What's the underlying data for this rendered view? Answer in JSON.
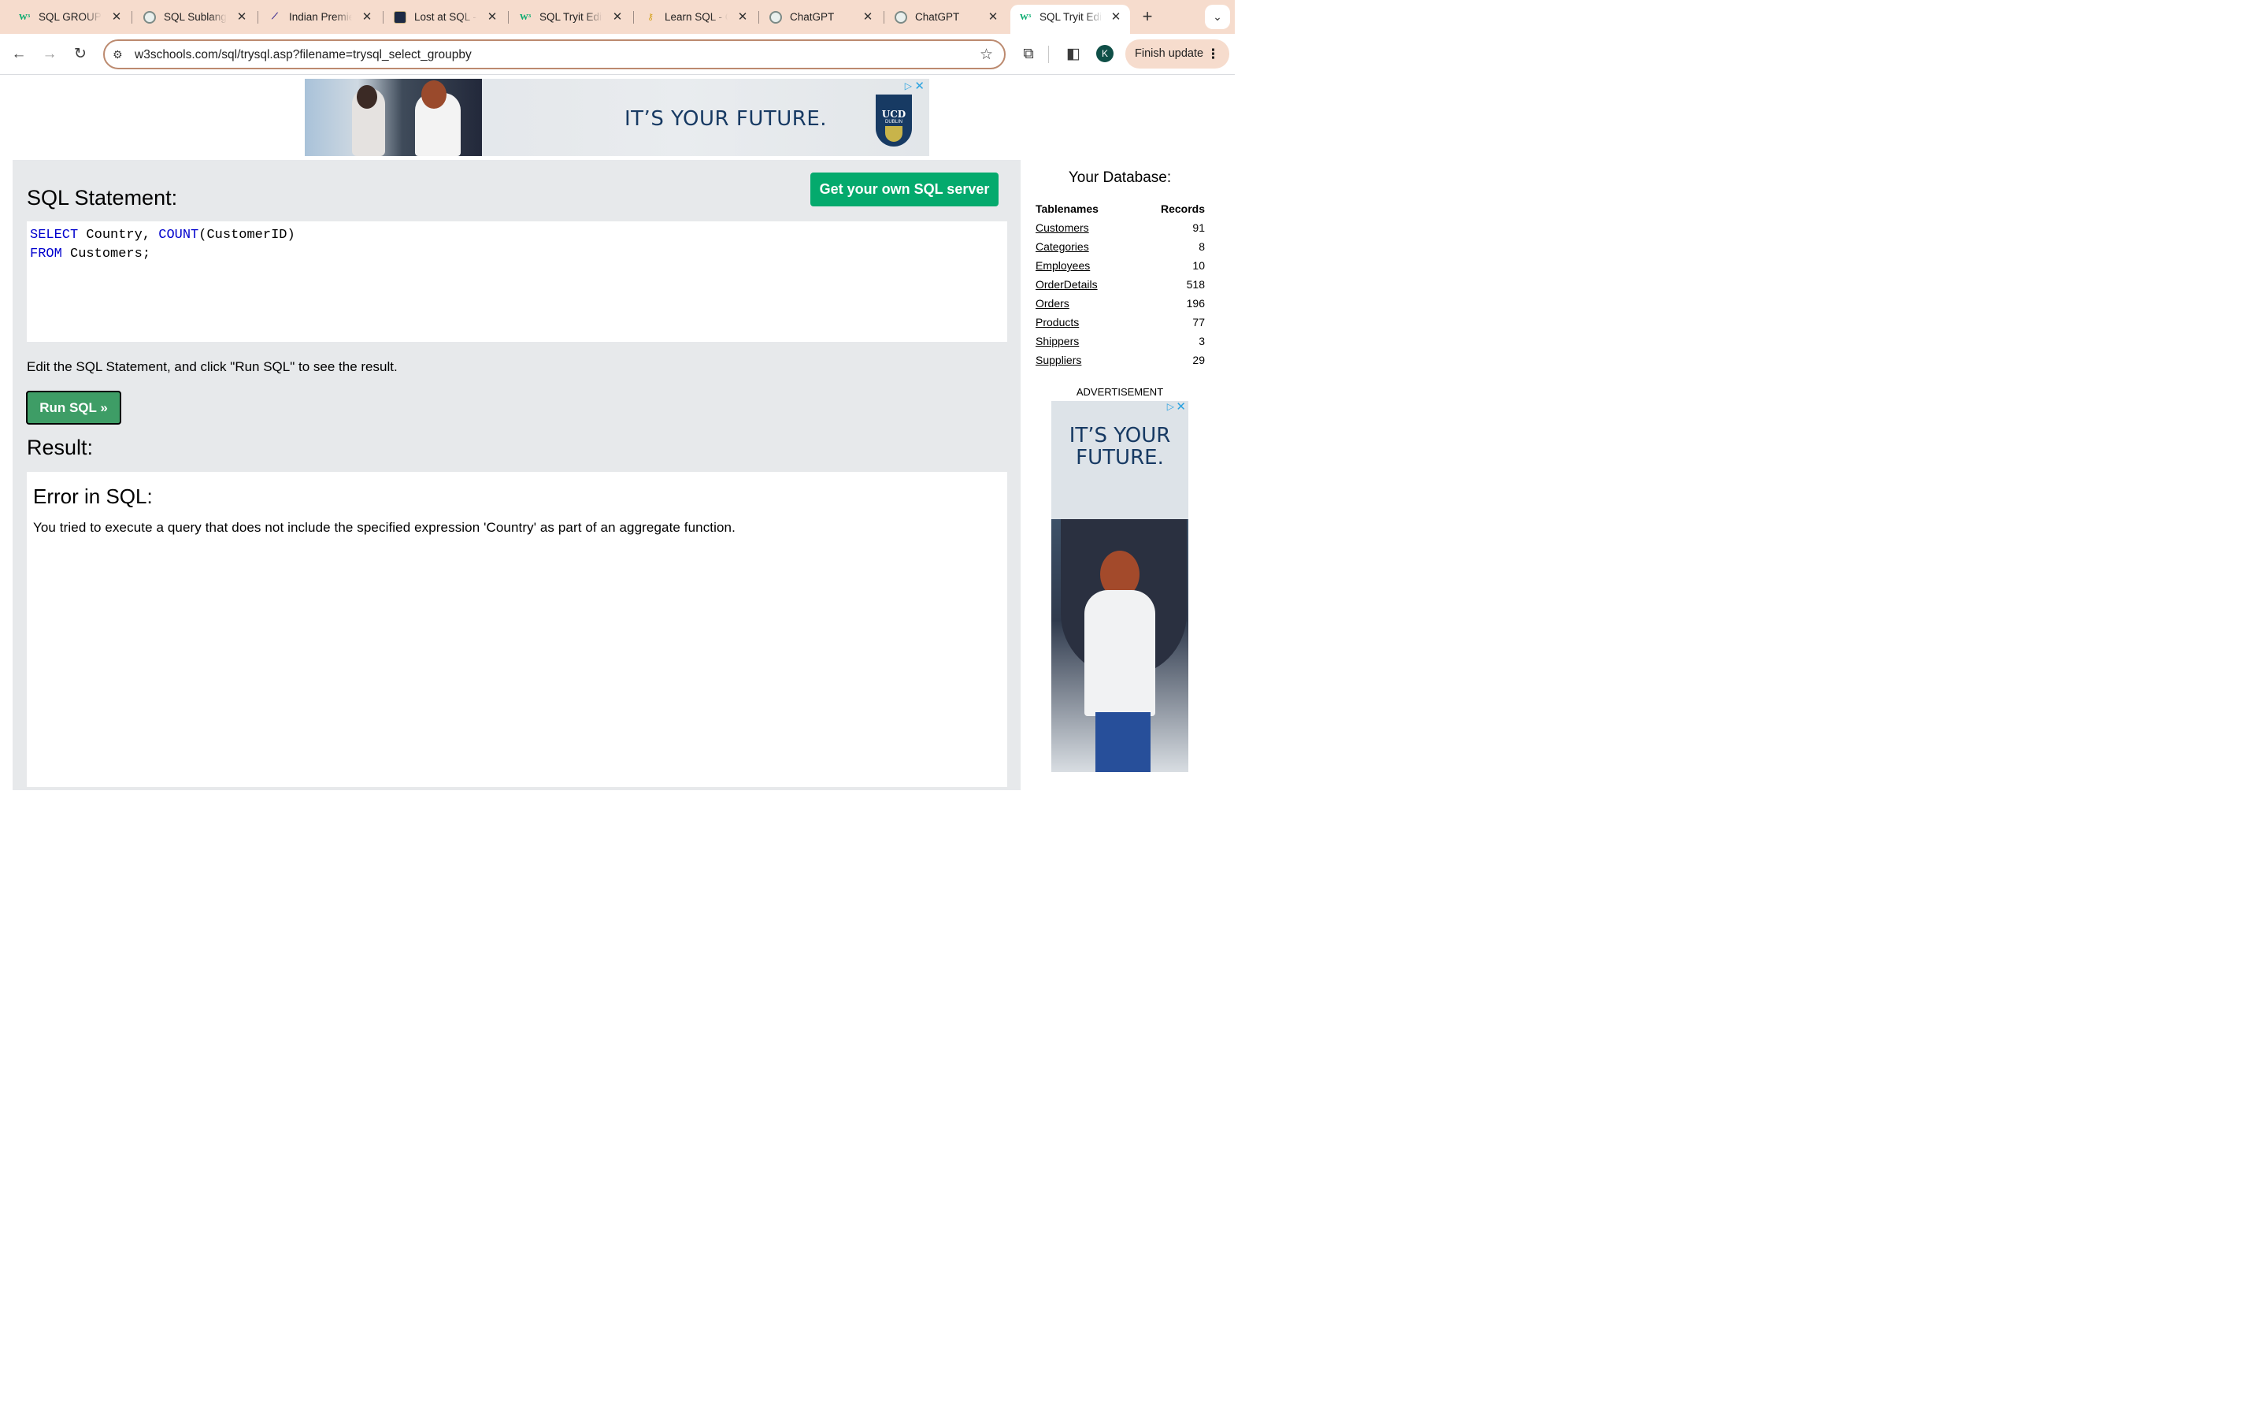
{
  "browser": {
    "tabs": [
      {
        "title": "SQL GROUP BY",
        "favicon": "w3schools-icon"
      },
      {
        "title": "SQL Sublanguages",
        "favicon": "chatgpt-icon"
      },
      {
        "title": "Indian Premier League",
        "favicon": "ipl-icon"
      },
      {
        "title": "Lost at SQL - Game",
        "favicon": "game-icon"
      },
      {
        "title": "SQL Tryit Editor",
        "favicon": "w3schools-icon"
      },
      {
        "title": "Learn SQL - Online",
        "favicon": "key-icon"
      },
      {
        "title": "ChatGPT",
        "favicon": "chatgpt-icon"
      },
      {
        "title": "ChatGPT",
        "favicon": "chatgpt-icon"
      },
      {
        "title": "SQL Tryit Editor",
        "favicon": "w3schools-icon",
        "active": true
      }
    ],
    "url": "w3schools.com/sql/trysql.asp?filename=trysql_select_groupby",
    "profile_initial": "K",
    "finish_update_label": "Finish update"
  },
  "top_ad": {
    "headline": "IT’S YOUR FUTURE.",
    "logo_text": "UCD",
    "logo_subtext": "DUBLIN"
  },
  "editor": {
    "heading": "SQL Statement:",
    "own_server_label": "Get your own SQL server",
    "line1": {
      "kw1": "SELECT",
      "t1": " Country, ",
      "kw2": "COUNT",
      "t2": "(CustomerID)"
    },
    "line2": {
      "kw1": "FROM",
      "t1": " Customers;"
    },
    "hint": "Edit the SQL Statement, and click \"Run SQL\" to see the result.",
    "run_label": "Run SQL »"
  },
  "result": {
    "heading": "Result:",
    "error_title": "Error in SQL:",
    "error_message": "You tried to execute a query that does not include the specified expression 'Country' as part of an aggregate function."
  },
  "database": {
    "title": "Your Database:",
    "col_names": "Tablenames",
    "col_records": "Records",
    "tables": [
      {
        "name": "Customers",
        "records": "91"
      },
      {
        "name": "Categories",
        "records": "8"
      },
      {
        "name": "Employees",
        "records": "10"
      },
      {
        "name": "OrderDetails",
        "records": "518"
      },
      {
        "name": "Orders",
        "records": "196"
      },
      {
        "name": "Products",
        "records": "77"
      },
      {
        "name": "Shippers",
        "records": "3"
      },
      {
        "name": "Suppliers",
        "records": "29"
      }
    ]
  },
  "side_ad": {
    "label": "ADVERTISEMENT",
    "headline": "IT’S YOUR FUTURE."
  },
  "colors": {
    "tab_strip": "#f6dccd",
    "w3_green": "#04aa6d",
    "run_button": "#3e9d66",
    "panel_bg": "#e7e9eb",
    "sql_keyword": "#0000cd",
    "ad_navy": "#173a63"
  }
}
